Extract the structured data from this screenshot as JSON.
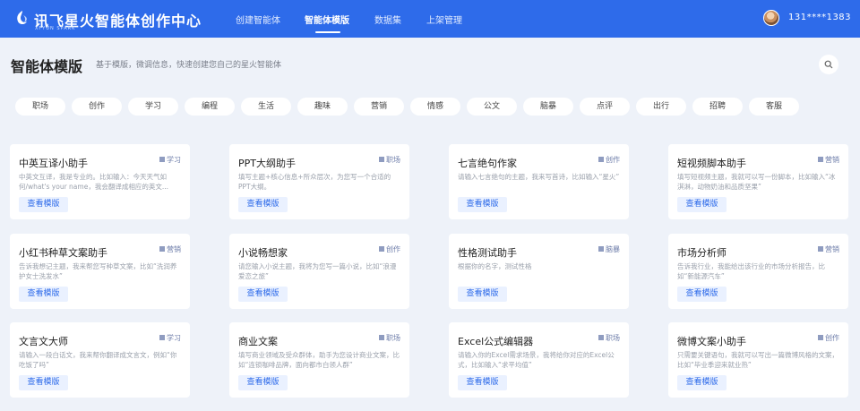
{
  "brand": {
    "logo_text": "讯飞星火",
    "logo_sub": "XFYUN SPARK",
    "app_title": "智能体创作中心"
  },
  "nav": [
    {
      "label": "创建智能体",
      "active": false
    },
    {
      "label": "智能体模版",
      "active": true
    },
    {
      "label": "数据集",
      "active": false
    },
    {
      "label": "上架管理",
      "active": false
    }
  ],
  "user": {
    "phone": "131****1383"
  },
  "header": {
    "title": "智能体模版",
    "description": "基于模版，微调信息，快速创建您自己的星火智能体"
  },
  "categories": [
    "职场",
    "创作",
    "学习",
    "编程",
    "生活",
    "趣味",
    "营销",
    "情感",
    "公文",
    "脑暴",
    "点评",
    "出行",
    "招聘",
    "客服"
  ],
  "card_button_label": "查看模版",
  "cards": [
    {
      "title": "中英互译小助手",
      "tag": "学习",
      "desc": "中英文互译，我是专业的。比如输入：今天天气如何/what's your name，我会翻译成相应的英文..."
    },
    {
      "title": "PPT大纲助手",
      "tag": "职场",
      "desc": "填写主题+核心信息+所众层次，为您写一个合适的PPT大纲。"
    },
    {
      "title": "七言绝句作家",
      "tag": "创作",
      "desc": "请输入七言绝句的主题，我来写首诗，比如输入“星火”"
    },
    {
      "title": "短视频脚本助手",
      "tag": "营销",
      "desc": "填写短视频主题，我就可以写一份脚本，比如输入“冰淇淋，动物奶油和品质坚果”"
    },
    {
      "title": "小红书种草文案助手",
      "tag": "营销",
      "desc": "告诉我想记主题，我来帮您写种草文案，比如“洗润养护女士洗发水”"
    },
    {
      "title": "小说畅想家",
      "tag": "创作",
      "desc": "请您输入小说主题，我将为您写一篇小说，比如“浪漫爱恋之旅”"
    },
    {
      "title": "性格测试助手",
      "tag": "脑暴",
      "desc": "根据你的名字，测试性格"
    },
    {
      "title": "市场分析师",
      "tag": "营销",
      "desc": "告诉我行业，我能给出该行业的市场分析报告，比如“新能源汽车”"
    },
    {
      "title": "文言文大师",
      "tag": "学习",
      "desc": "请输入一段白话文，我来帮你翻译成文言文，例如“你吃饭了吗”"
    },
    {
      "title": "商业文案",
      "tag": "职场",
      "desc": "填写商业领域及受众群体，助手为您设计商业文案，比如“连锁咖啡品牌，面向都市白领人群”"
    },
    {
      "title": "Excel公式编辑器",
      "tag": "职场",
      "desc": "请输入你的Excel需求场景，我将给你对应的Excel公式，比如输入“求平均值”"
    },
    {
      "title": "微博文案小助手",
      "tag": "创作",
      "desc": "只需要关键语句，我就可以写出一篇微博风格的文案，比如“毕业季迎来就业热”"
    }
  ],
  "colors": {
    "primary": "#2e6bea",
    "background": "#eef2f9",
    "card": "#ffffff",
    "button_bg": "#eaf1ff"
  },
  "icons": {
    "logo": "spark-logo-icon",
    "search": "search-icon",
    "tag": "tag-icon"
  }
}
